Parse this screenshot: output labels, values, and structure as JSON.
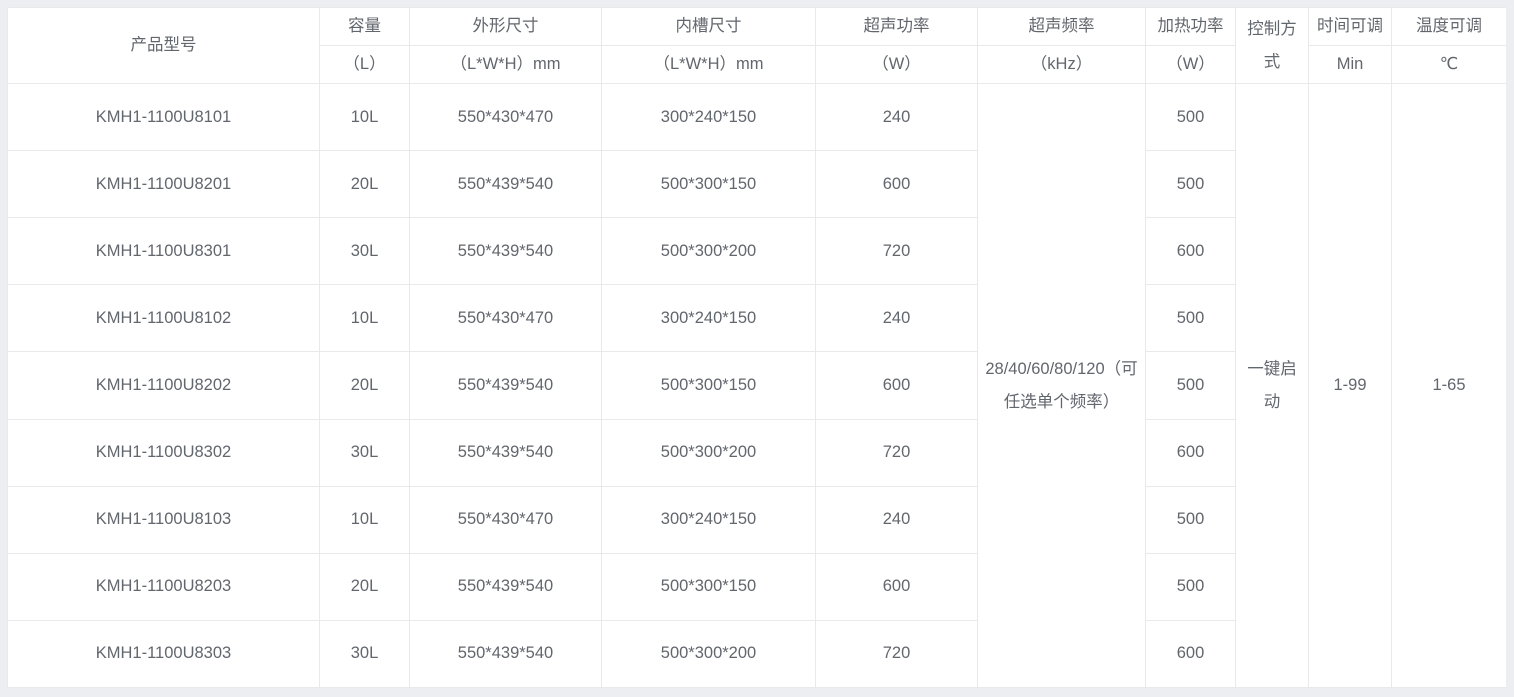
{
  "table": {
    "header_row1": [
      {
        "label": "产品型号",
        "name": "col-header-product-model"
      },
      {
        "label": "容量",
        "name": "col-header-capacity"
      },
      {
        "label": "外形尺寸",
        "name": "col-header-outer-dimensions"
      },
      {
        "label": "内槽尺寸",
        "name": "col-header-inner-tank-dimensions"
      },
      {
        "label": "超声功率",
        "name": "col-header-ultrasonic-power"
      },
      {
        "label": "超声频率",
        "name": "col-header-ultrasonic-frequency"
      },
      {
        "label": "加热功率",
        "name": "col-header-heating-power"
      },
      {
        "label": "控制方式",
        "name": "col-header-control-mode"
      },
      {
        "label": "时间可调",
        "name": "col-header-time-adjustable"
      },
      {
        "label": "温度可调",
        "name": "col-header-temperature-adjustable"
      }
    ],
    "header_row2": [
      {
        "label": "",
        "name": "unit-header-product-model"
      },
      {
        "label": "（L）",
        "name": "unit-header-capacity"
      },
      {
        "label": "（L*W*H）mm",
        "name": "unit-header-outer-dimensions"
      },
      {
        "label": "（L*W*H）mm",
        "name": "unit-header-inner-tank-dimensions"
      },
      {
        "label": "（W）",
        "name": "unit-header-ultrasonic-power"
      },
      {
        "label": "（kHz）",
        "name": "unit-header-ultrasonic-frequency"
      },
      {
        "label": "（W）",
        "name": "unit-header-heating-power"
      },
      {
        "label": "Min",
        "name": "unit-header-time-adjustable"
      },
      {
        "label": "℃",
        "name": "unit-header-temperature-adjustable"
      }
    ],
    "rows": [
      {
        "model": "KMH1-1100U8101",
        "capacity": "10L",
        "outer": "550*430*470",
        "inner": "300*240*150",
        "power": "240",
        "heat": "500"
      },
      {
        "model": "KMH1-1100U8201",
        "capacity": "20L",
        "outer": "550*439*540",
        "inner": "500*300*150",
        "power": "600",
        "heat": "500"
      },
      {
        "model": "KMH1-1100U8301",
        "capacity": "30L",
        "outer": "550*439*540",
        "inner": "500*300*200",
        "power": "720",
        "heat": "600"
      },
      {
        "model": "KMH1-1100U8102",
        "capacity": "10L",
        "outer": "550*430*470",
        "inner": "300*240*150",
        "power": "240",
        "heat": "500"
      },
      {
        "model": "KMH1-1100U8202",
        "capacity": "20L",
        "outer": "550*439*540",
        "inner": "500*300*150",
        "power": "600",
        "heat": "500"
      },
      {
        "model": "KMH1-1100U8302",
        "capacity": "30L",
        "outer": "550*439*540",
        "inner": "500*300*200",
        "power": "720",
        "heat": "600"
      },
      {
        "model": "KMH1-1100U8103",
        "capacity": "10L",
        "outer": "550*430*470",
        "inner": "300*240*150",
        "power": "240",
        "heat": "500"
      },
      {
        "model": "KMH1-1100U8203",
        "capacity": "20L",
        "outer": "550*439*540",
        "inner": "500*300*150",
        "power": "600",
        "heat": "500"
      },
      {
        "model": "KMH1-1100U8303",
        "capacity": "30L",
        "outer": "550*439*540",
        "inner": "500*300*200",
        "power": "720",
        "heat": "600"
      }
    ],
    "merged": {
      "frequency": "28/40/60/80/120（可任选单个频率）",
      "control_mode": "一键启动",
      "time_range": "1-99",
      "temperature_range": "1-65"
    }
  },
  "colors": {
    "page_background": "#eceef2",
    "table_background": "#ffffff",
    "border": "#e9e9ea",
    "text": "#62666d"
  }
}
